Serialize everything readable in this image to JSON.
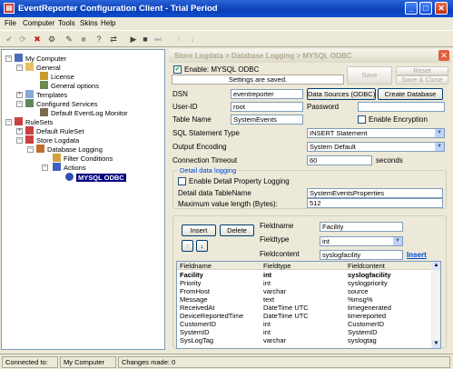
{
  "window": {
    "title": "EventReporter Configuration Client - Trial Period"
  },
  "menu": [
    "File",
    "Computer",
    "Tools",
    "Skins",
    "Help"
  ],
  "tree": {
    "root": "My Computer",
    "general": "General",
    "license": "License",
    "general_options": "General options",
    "templates": "Templates",
    "configured_services": "Configured Services",
    "default_monitor": "Default EventLog Monitor",
    "rulesets": "RuleSets",
    "default_ruleset": "Default RuleSet",
    "store_logdata": "Store Logdata",
    "database_logging": "Database Logging",
    "filter_conditions": "Filter Conditions",
    "actions": "Actions",
    "mysql_odbc": "MYSQL ODBC"
  },
  "panel": {
    "breadcrumb": "Store Logdata > Database Logging > MYSQL ODBC",
    "enable_label": "Enable: MYSQL ODBC",
    "status": "Settings are saved.",
    "save": "Save",
    "reset": "Reset",
    "save_close": "Save & Close",
    "dsn_label": "DSN",
    "dsn_value": "eventreporter",
    "data_sources_btn": "Data Sources (ODBC)",
    "create_db_btn": "Create Database",
    "userid_label": "User-ID",
    "userid_value": "root",
    "password_label": "Password",
    "password_value": "",
    "table_label": "Table Name",
    "table_value": "SystemEvents",
    "encryption_label": "Enable Encryption",
    "sql_type_label": "SQL Statement Type",
    "sql_type_value": "INSERT Statement",
    "output_enc_label": "Output Encoding",
    "output_enc_value": "System Default",
    "timeout_label": "Connection Timeout",
    "timeout_value": "60",
    "timeout_unit": "seconds",
    "detail_group": "Detail data logging",
    "detail_enable_label": "Enable Detail Property Logging",
    "detail_table_label": "Detail data TableName",
    "detail_table_value": "SystemEventsProperties",
    "max_len_label": "Maximum value length (Bytes):",
    "max_len_value": "512",
    "insert_btn": "Insert",
    "delete_btn": "Delete",
    "fieldname_label": "Fieldname",
    "fieldname_value": "Facility",
    "fieldtype_label": "Fieldtype",
    "fieldtype_value": "int",
    "fieldcontent_label": "Fieldcontent",
    "fieldcontent_value": "syslogfacility",
    "insert_link": "Insert"
  },
  "grid": {
    "columns": [
      "Fieldname",
      "Fieldtype",
      "Fieldcontent"
    ],
    "rows": [
      [
        "Facility",
        "int",
        "syslogfacility"
      ],
      [
        "Priority",
        "int",
        "syslogpriority"
      ],
      [
        "FromHost",
        "varchar",
        "source"
      ],
      [
        "Message",
        "text",
        "%msg%"
      ],
      [
        "ReceivedAt",
        "DateTime UTC",
        "timegenerated"
      ],
      [
        "DeviceReportedTime",
        "DateTime UTC",
        "timereported"
      ],
      [
        "CustomerID",
        "int",
        "CustomerID"
      ],
      [
        "SystemID",
        "int",
        "SystemID"
      ],
      [
        "SysLogTag",
        "varchar",
        "syslogtag"
      ]
    ]
  },
  "status": {
    "connected_label": "Connected to:",
    "connected_value": "My Computer",
    "changes": "Changes made: 0"
  }
}
